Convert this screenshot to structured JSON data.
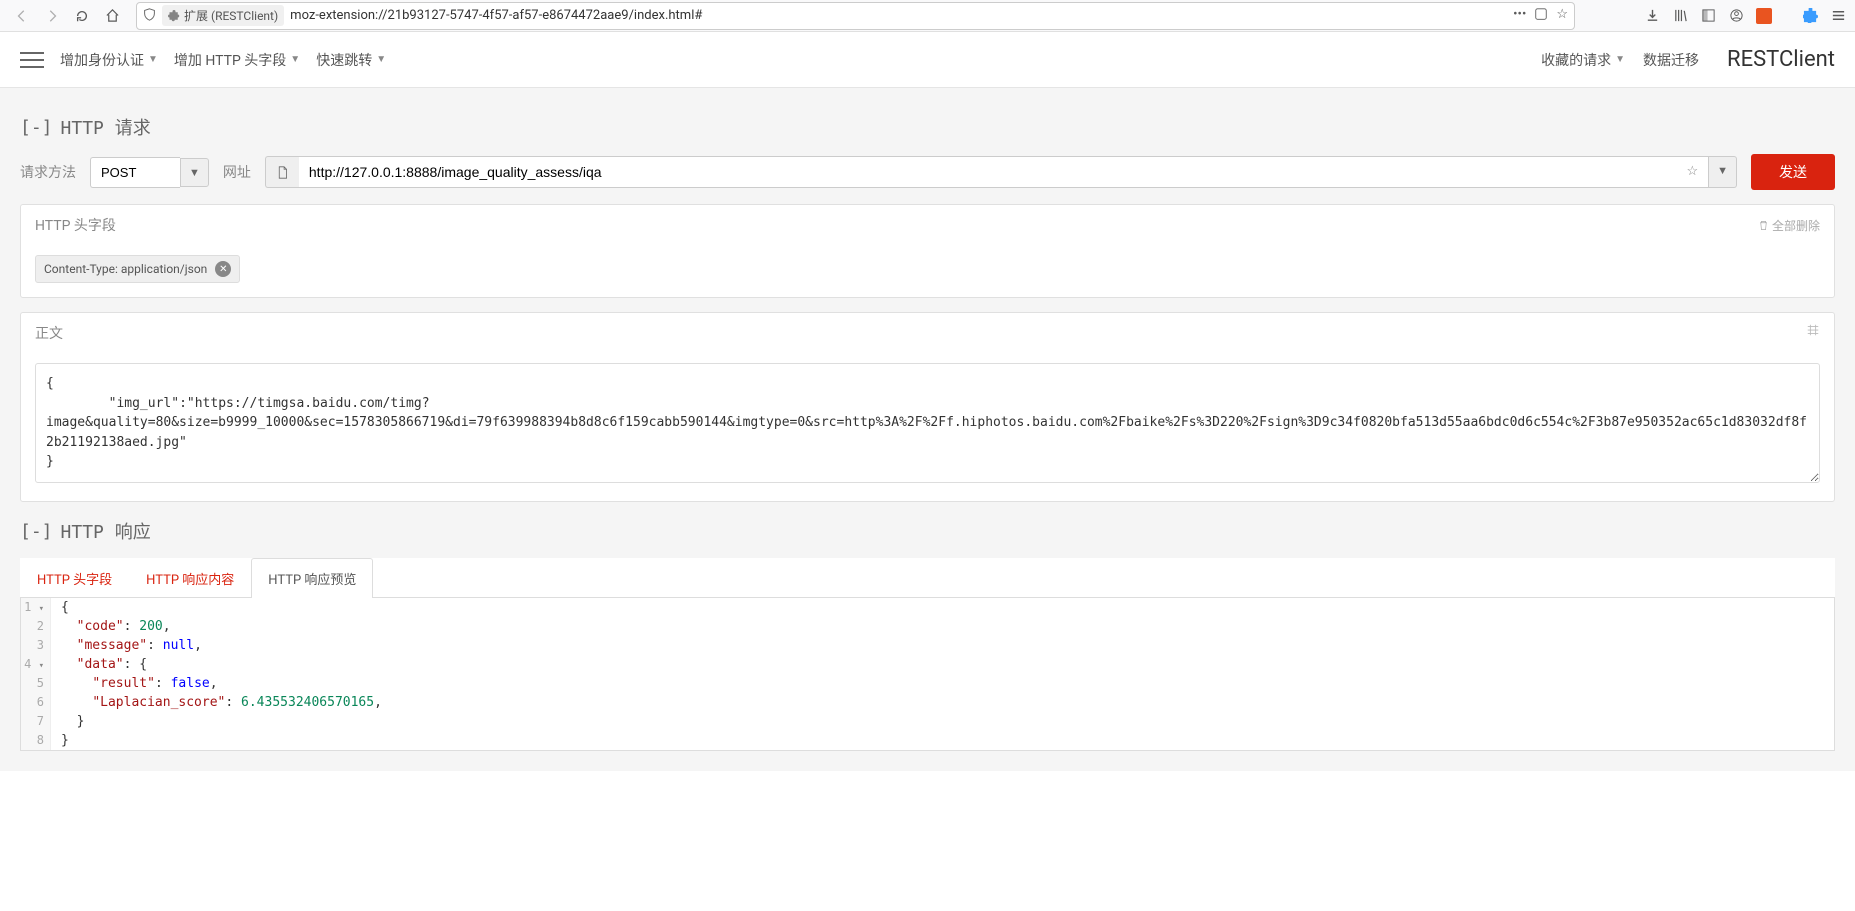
{
  "browser": {
    "page_title": "扩展 (RESTClient)",
    "url": "moz-extension://21b93127-5747-4f57-af57-e8674472aae9/index.html#"
  },
  "header": {
    "menu_auth": "增加身份认证",
    "menu_headers": "增加 HTTP 头字段",
    "menu_quick": "快速跳转",
    "fav_requests": "收藏的请求",
    "data_migrate": "数据迁移",
    "brand": "RESTClient"
  },
  "request": {
    "section_title": "HTTP 请求",
    "method_label": "请求方法",
    "method_value": "POST",
    "url_label": "网址",
    "url_value": "http://127.0.0.1:8888/image_quality_assess/iqa",
    "send_label": "发送"
  },
  "headers_panel": {
    "title": "HTTP 头字段",
    "delete_all": "全部删除",
    "tag_text": "Content-Type: application/json"
  },
  "body_panel": {
    "title": "正文",
    "body_text": "{\n        \"img_url\":\"https://timgsa.baidu.com/timg?image&quality=80&size=b9999_10000&sec=1578305866719&di=79f639988394b8d8c6f159cabb590144&imgtype=0&src=http%3A%2F%2Ff.hiphotos.baidu.com%2Fbaike%2Fs%3D220%2Fsign%3D9c34f0820bfa513d55aa6bdc0d6c554c%2F3b87e950352ac65c1d83032df8f2b21192138aed.jpg\"\n}"
  },
  "response": {
    "section_title": "HTTP 响应",
    "tab_headers": "HTTP 头字段",
    "tab_body": "HTTP 响应内容",
    "tab_preview": "HTTP 响应预览",
    "json_lines": {
      "l1": "{",
      "l2_key": "\"code\"",
      "l2_val": "200",
      "l3_key": "\"message\"",
      "l3_val": "null",
      "l4_key": "\"data\"",
      "l5_key": "\"result\"",
      "l5_val": "false",
      "l6_key": "\"Laplacian_score\"",
      "l6_val": "6.435532406570165",
      "l7": "  }",
      "l8": "}"
    }
  }
}
